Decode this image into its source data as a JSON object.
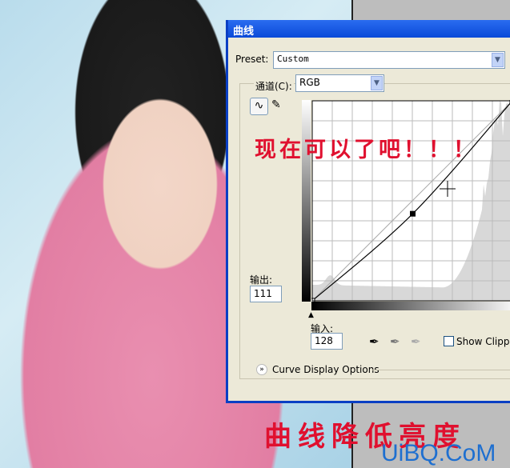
{
  "dialog": {
    "title": "曲线",
    "preset_label": "Preset:",
    "preset_value": "Custom",
    "channel_label": "通道(C):",
    "channel_value": "RGB",
    "output_label": "输出:",
    "output_value": "111",
    "input_label": "输入:",
    "input_value": "128",
    "show_clipping_label": "Show Clipping",
    "curve_display_options_label": "Curve Display Options"
  },
  "curve": {
    "points": [
      [
        0,
        0
      ],
      [
        128,
        111
      ],
      [
        255,
        255
      ]
    ],
    "range": [
      0,
      255
    ],
    "grid_divisions": 10
  },
  "annotations": {
    "caption_top": "现在可以了吧！！！",
    "caption_bottom": "曲线降低亮度",
    "watermark": "UiBQ.CoM"
  },
  "colors": {
    "annotation": "#e0102f",
    "watermark": "#1e6fd0",
    "titlebar": "#0a4ad8"
  }
}
